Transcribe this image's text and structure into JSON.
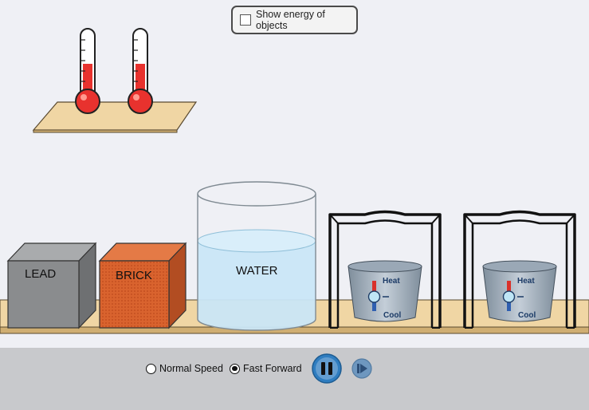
{
  "energy_toggle": {
    "label": "Show energy of objects",
    "checked": false
  },
  "objects": {
    "lead": "LEAD",
    "brick": "BRICK",
    "water": "WATER"
  },
  "burners": [
    {
      "heat": "Heat",
      "cool": "Cool"
    },
    {
      "heat": "Heat",
      "cool": "Cool"
    }
  ],
  "speed": {
    "normal_label": "Normal Speed",
    "fast_label": "Fast Forward",
    "selected": "fast"
  },
  "thermometers": [
    {
      "level": 0.6
    },
    {
      "level": 0.6
    }
  ],
  "colors": {
    "background": "#eff0f5",
    "shelf": "#f0d6a4",
    "mercury": "#e8322e",
    "water": "#c9e6f7",
    "lead": "#8a8c8e",
    "brick": "#d9632e",
    "control_bar": "#c8c9cc",
    "play_button": "#2f7dc0"
  },
  "icons": {
    "pause": "pause-icon",
    "step": "step-icon"
  }
}
